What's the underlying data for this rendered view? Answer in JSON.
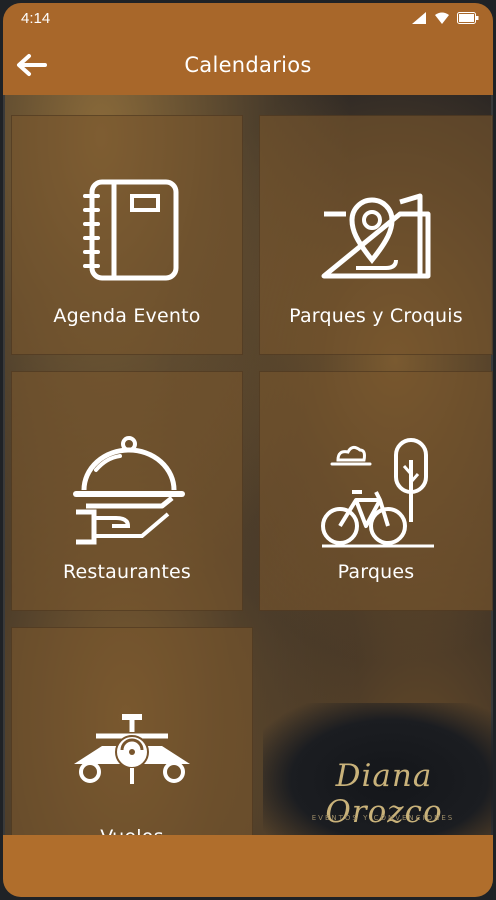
{
  "status_bar": {
    "time": "4:14"
  },
  "app_bar": {
    "title": "Calendarios"
  },
  "tiles": [
    {
      "label": "Agenda Evento"
    },
    {
      "label": "Parques y Croquis"
    },
    {
      "label": "Restaurantes"
    },
    {
      "label": "Parques"
    },
    {
      "label": "Vuelos"
    }
  ],
  "brand": {
    "name": "Diana Orozco",
    "tagline": "EVENTOS Y CONVENCIONES"
  },
  "colors": {
    "accent": "#a8672a",
    "tile": "#78552d",
    "brand_gold": "#c9b27a"
  }
}
